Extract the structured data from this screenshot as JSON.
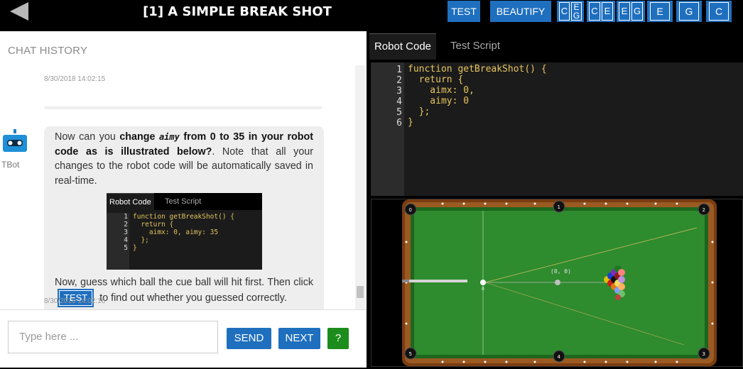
{
  "header": {
    "title": "[1] A SIMPLE BREAK SHOT",
    "test_label": "TEST",
    "beautify_label": "BEAUTIFY",
    "combo_1": [
      "C",
      "E",
      "G"
    ],
    "combo_2": [
      "C",
      "E"
    ],
    "combo_3": [
      "E",
      "G"
    ],
    "single_e": "E",
    "single_g": "G",
    "single_c": "C"
  },
  "chat": {
    "title": "CHAT HISTORY",
    "top_timestamp": "8/30/2018 14:02:15",
    "bot_name": "TBot",
    "msg1_part1": "Now can you ",
    "msg1_bold1": "change ",
    "msg1_code": "aimy",
    "msg1_bold2": " from 0 to 35 in your robot code as is illustrated below?",
    "msg1_part2": ". Note that all your changes to the robot code will be automatically saved in real-time.",
    "msg2_part1": "Now, guess which ball the cue ball will hit first. Then click",
    "msg2_button": "TEST",
    "msg2_part2": "to find out whether you guessed correctly.",
    "bottom_timestamp": "8/30/2018 14:02:16",
    "mini": {
      "tab_active": "Robot Code",
      "tab_other": "Test Script",
      "lines": [
        "function getBreakShot() {",
        "  return {",
        "    aimx: 0, aimy: 35",
        "  };",
        "}"
      ],
      "line_numbers": [
        "1",
        "2",
        "3",
        "4",
        "5"
      ]
    }
  },
  "input": {
    "placeholder": "Type here ...",
    "send_label": "SEND",
    "next_label": "NEXT",
    "help_label": "?"
  },
  "editor": {
    "tab_active": "Robot Code",
    "tab_other": "Test Script",
    "line_numbers": [
      "1",
      "2",
      "3",
      "4",
      "5",
      "6"
    ],
    "lines": [
      "function getBreakShot() {",
      "  return {",
      "    aimx: 0,",
      "    aimy: 0",
      "  };",
      "}"
    ]
  },
  "table": {
    "pocket_labels": [
      "0",
      "1",
      "2",
      "3",
      "4",
      "5"
    ],
    "origin_label": "(0, 0)",
    "cue_ball_label": "0",
    "colors": {
      "felt": "#2e8b2e",
      "rail": "#8b4a1a",
      "cushion": "#1f6a1f",
      "pocket": "#111111"
    }
  }
}
